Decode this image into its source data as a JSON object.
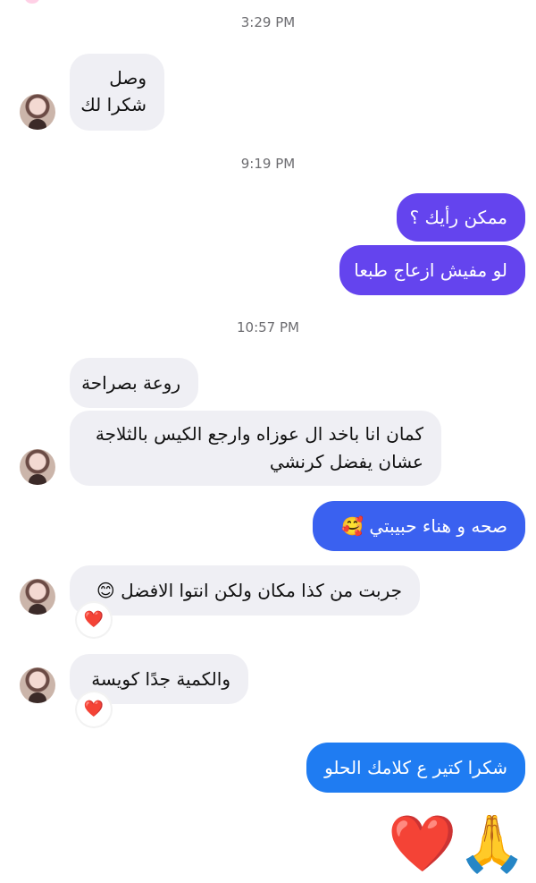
{
  "conversation": {
    "timestamps": [
      "3:29 PM",
      "9:19 PM",
      "10:57 PM"
    ],
    "received_1": {
      "line1": "وصل",
      "line2": "شكرا لك"
    },
    "sent_1": "ممكن رأيك ؟",
    "sent_2": "لو مفيش ازعاج طبعا",
    "received_2": "روعة بصراحة",
    "received_3": {
      "line1": "كمان انا باخد ال عوزاه وارجع الكيس بالثلاجة",
      "line2": "عشان يفضل كرنشي"
    },
    "sent_3": "صحه و هناء حبيبتي 🥰",
    "received_4": "جربت من كذا مكان ولكن انتوا الافضل 😊",
    "received_4_reaction": "❤️",
    "received_5": "والكمية جدًا كويسة",
    "received_5_reaction": "❤️",
    "sent_4": "شكرا كتير ع كلامك الحلو",
    "sent_emoji": {
      "heart": "❤️",
      "pray": "🙏"
    }
  },
  "icons": {
    "avatar": "avatar",
    "reaction": "heart-reaction-icon"
  },
  "colors": {
    "sent_purple": "#6444ee",
    "sent_blue": "#1f7cf2",
    "received_bg": "#efeff4"
  }
}
